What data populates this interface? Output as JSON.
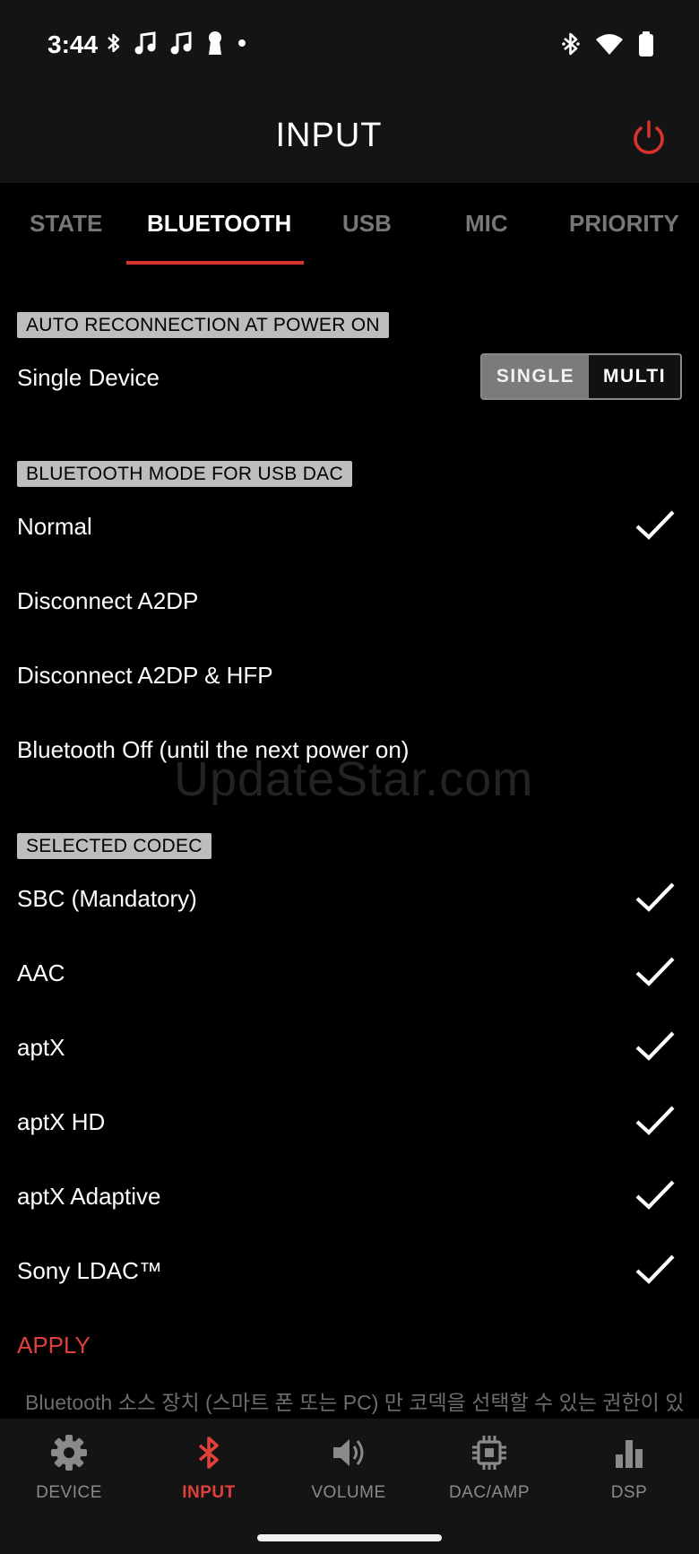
{
  "status_bar": {
    "time": "3:44",
    "left_icons": [
      "bluetooth-icon",
      "music-note-icon",
      "music-note-icon",
      "keyhole-icon",
      "dot-icon"
    ],
    "right_icons": [
      "bluetooth-icon",
      "wifi-icon",
      "battery-icon"
    ]
  },
  "header": {
    "title": "INPUT",
    "power_icon": "power-icon",
    "accent_color": "#d8322f"
  },
  "tabs": [
    {
      "label": "STATE",
      "active": false
    },
    {
      "label": "BLUETOOTH",
      "active": true
    },
    {
      "label": "USB",
      "active": false
    },
    {
      "label": "MIC",
      "active": false
    },
    {
      "label": "PRIORITY",
      "active": false
    }
  ],
  "auto_reconnect": {
    "section_title": "AUTO RECONNECTION AT POWER ON",
    "row_label": "Single Device",
    "options": [
      "SINGLE",
      "MULTI"
    ],
    "selected": "SINGLE"
  },
  "usb_dac_mode": {
    "section_title": "BLUETOOTH MODE FOR USB DAC",
    "options": [
      {
        "label": "Normal",
        "checked": true
      },
      {
        "label": "Disconnect A2DP",
        "checked": false
      },
      {
        "label": "Disconnect A2DP & HFP",
        "checked": false
      },
      {
        "label": "Bluetooth Off (until the next power on)",
        "checked": false
      }
    ]
  },
  "watermark": "UpdateStar.com",
  "codec": {
    "section_title": "SELECTED CODEC",
    "options": [
      {
        "label": "SBC (Mandatory)",
        "checked": true
      },
      {
        "label": "AAC",
        "checked": true
      },
      {
        "label": "aptX",
        "checked": true
      },
      {
        "label": "aptX HD",
        "checked": true
      },
      {
        "label": "aptX Adaptive",
        "checked": true
      },
      {
        "label": "Sony LDAC™",
        "checked": true
      }
    ]
  },
  "apply_label": "APPLY",
  "note": "Bluetooth 소스 장치 (스마트 폰 또는 PC) 만 코덱을 선택할 수 있는 권한이 있",
  "bottom_nav": [
    {
      "label": "DEVICE",
      "icon": "gear-icon",
      "active": false
    },
    {
      "label": "INPUT",
      "icon": "bluetooth-icon",
      "active": true
    },
    {
      "label": "VOLUME",
      "icon": "speaker-icon",
      "active": false
    },
    {
      "label": "DAC/AMP",
      "icon": "chip-icon",
      "active": false
    },
    {
      "label": "DSP",
      "icon": "equalizer-icon",
      "active": false
    }
  ]
}
